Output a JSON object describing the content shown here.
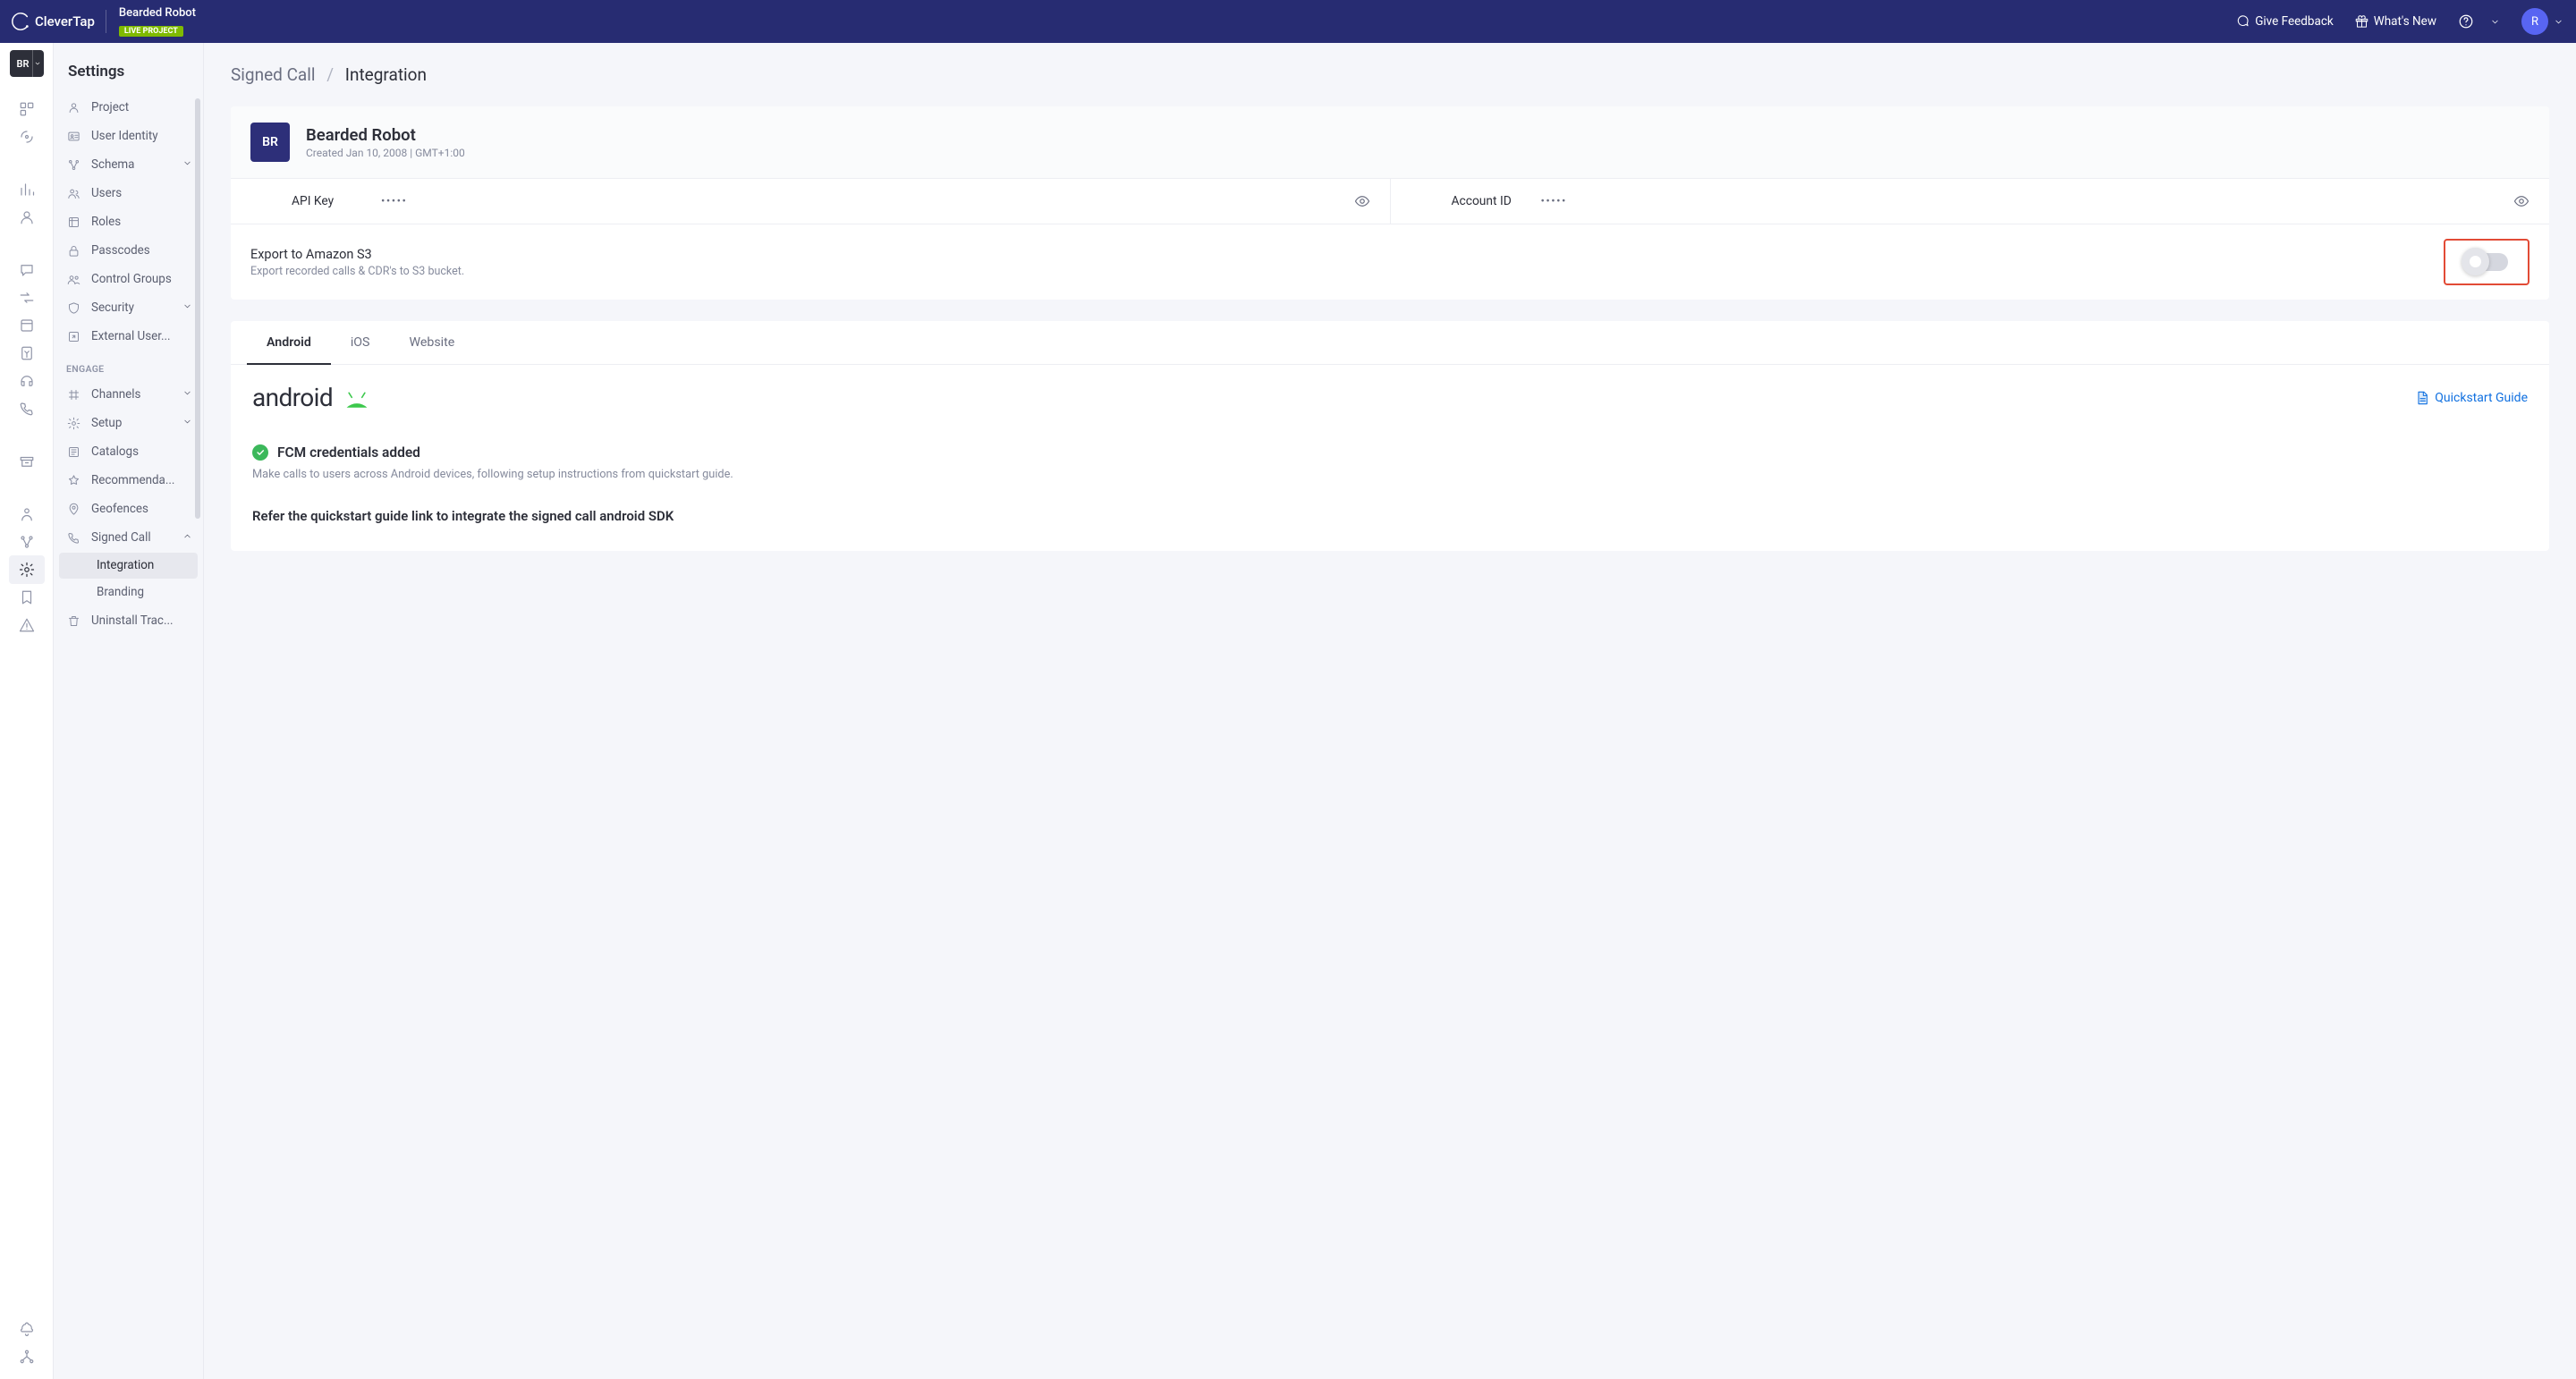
{
  "header": {
    "brand": "CleverTap",
    "project_name": "Bearded Robot",
    "project_badge": "LIVE PROJECT",
    "feedback": "Give Feedback",
    "whats_new": "What's New",
    "avatar_initial": "R"
  },
  "leftrail": {
    "selector_label": "BR"
  },
  "sidebar": {
    "title": "Settings",
    "items": [
      {
        "label": "Project",
        "icon": "user"
      },
      {
        "label": "User Identity",
        "icon": "id"
      },
      {
        "label": "Schema",
        "icon": "schema",
        "chevron": true
      },
      {
        "label": "Users",
        "icon": "users"
      },
      {
        "label": "Roles",
        "icon": "roles"
      },
      {
        "label": "Passcodes",
        "icon": "lock"
      },
      {
        "label": "Control Groups",
        "icon": "group"
      },
      {
        "label": "Security",
        "icon": "shield",
        "chevron": true
      },
      {
        "label": "External User...",
        "icon": "ext"
      }
    ],
    "engage_label": "ENGAGE",
    "engage_items": [
      {
        "label": "Channels",
        "icon": "channels",
        "chevron": true
      },
      {
        "label": "Setup",
        "icon": "setup",
        "chevron": true
      },
      {
        "label": "Catalogs",
        "icon": "catalog"
      },
      {
        "label": "Recommenda...",
        "icon": "recs"
      },
      {
        "label": "Geofences",
        "icon": "geo"
      }
    ],
    "signed_call": {
      "label": "Signed Call",
      "icon": "phone"
    },
    "signed_call_children": [
      {
        "label": "Integration",
        "active": true
      },
      {
        "label": "Branding"
      }
    ],
    "uninstall": {
      "label": "Uninstall Trac...",
      "icon": "uninstall"
    }
  },
  "breadcrumb": {
    "parent": "Signed Call",
    "current": "Integration"
  },
  "project_card": {
    "avatar": "BR",
    "title": "Bearded Robot",
    "subtitle": "Created Jan 10, 2008 | GMT+1:00",
    "api_key_label": "API Key",
    "api_key_value": "•••••",
    "account_id_label": "Account ID",
    "account_id_value": "•••••",
    "export_title": "Export to Amazon S3",
    "export_desc": "Export recorded calls & CDR's to S3 bucket."
  },
  "tabs": [
    "Android",
    "iOS",
    "Website"
  ],
  "android_pane": {
    "logo_text": "android",
    "quickstart": "Quickstart Guide",
    "status_title": "FCM credentials added",
    "status_sub": "Make calls to users across Android devices, following setup instructions from quickstart guide.",
    "integrate": "Refer the quickstart guide link to integrate the signed call android SDK"
  }
}
